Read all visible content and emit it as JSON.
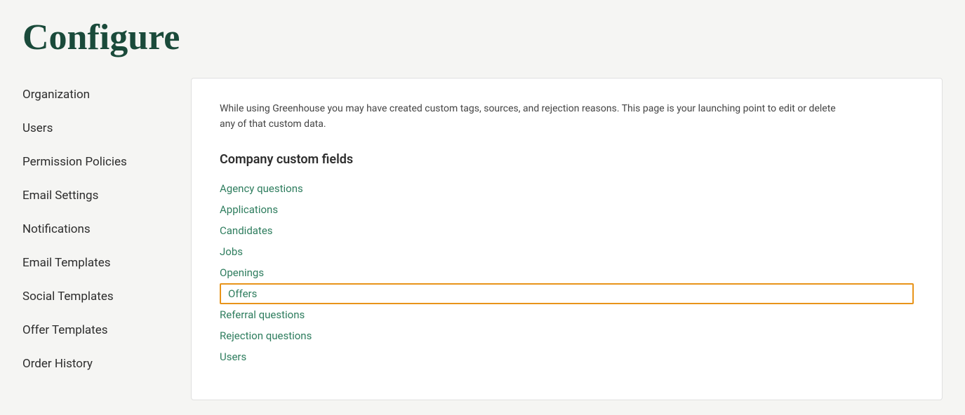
{
  "page": {
    "title": "Configure"
  },
  "sidebar": {
    "items": [
      {
        "label": "Organization",
        "id": "organization"
      },
      {
        "label": "Users",
        "id": "users"
      },
      {
        "label": "Permission Policies",
        "id": "permission-policies"
      },
      {
        "label": "Email Settings",
        "id": "email-settings"
      },
      {
        "label": "Notifications",
        "id": "notifications"
      },
      {
        "label": "Email Templates",
        "id": "email-templates"
      },
      {
        "label": "Social Templates",
        "id": "social-templates"
      },
      {
        "label": "Offer Templates",
        "id": "offer-templates"
      },
      {
        "label": "Order History",
        "id": "order-history"
      }
    ]
  },
  "main": {
    "description": "While using Greenhouse you may have created custom tags, sources, and rejection reasons. This page is your launching point to edit or delete any of that custom data.",
    "section_title": "Company custom fields",
    "links": [
      {
        "label": "Agency questions",
        "highlighted": false
      },
      {
        "label": "Applications",
        "highlighted": false
      },
      {
        "label": "Candidates",
        "highlighted": false
      },
      {
        "label": "Jobs",
        "highlighted": false
      },
      {
        "label": "Openings",
        "highlighted": false
      },
      {
        "label": "Offers",
        "highlighted": true
      },
      {
        "label": "Referral questions",
        "highlighted": false
      },
      {
        "label": "Rejection questions",
        "highlighted": false
      },
      {
        "label": "Users",
        "highlighted": false
      }
    ]
  }
}
